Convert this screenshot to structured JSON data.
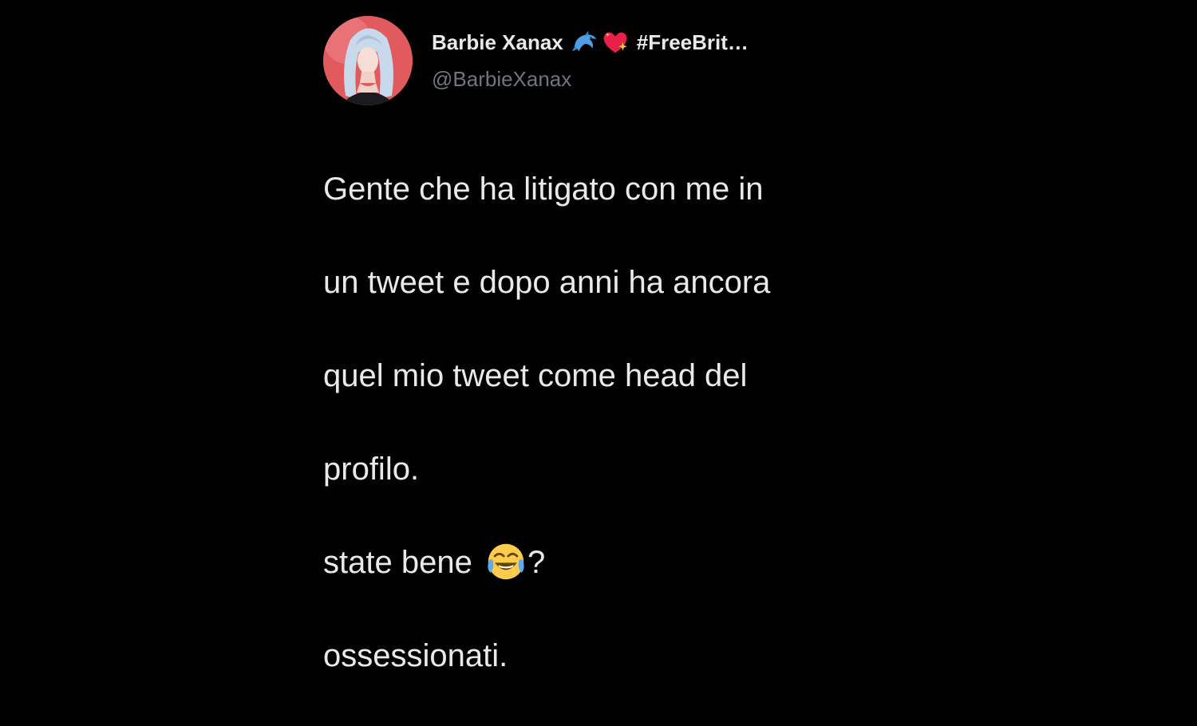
{
  "tweet": {
    "author": {
      "display_name": "Barbie Xanax",
      "name_emojis": [
        "dolphin-emoji",
        "sparkling-heart-emoji"
      ],
      "name_suffix": "#FreeBrit…",
      "handle": "@BarbieXanax",
      "avatar_icon": "profile-photo"
    },
    "text_lines": [
      "Gente che ha litigato con me in",
      "un tweet e dopo anni ha ancora",
      "quel mio tweet come head del",
      "profilo."
    ],
    "line5_before": "state bene ",
    "line5_emoji": "face-with-tears-of-joy-emoji",
    "line5_after": "?",
    "line6": "ossessionati."
  },
  "colors": {
    "background": "#000000",
    "text_primary": "#e7e9ea",
    "text_secondary": "#71767b"
  }
}
